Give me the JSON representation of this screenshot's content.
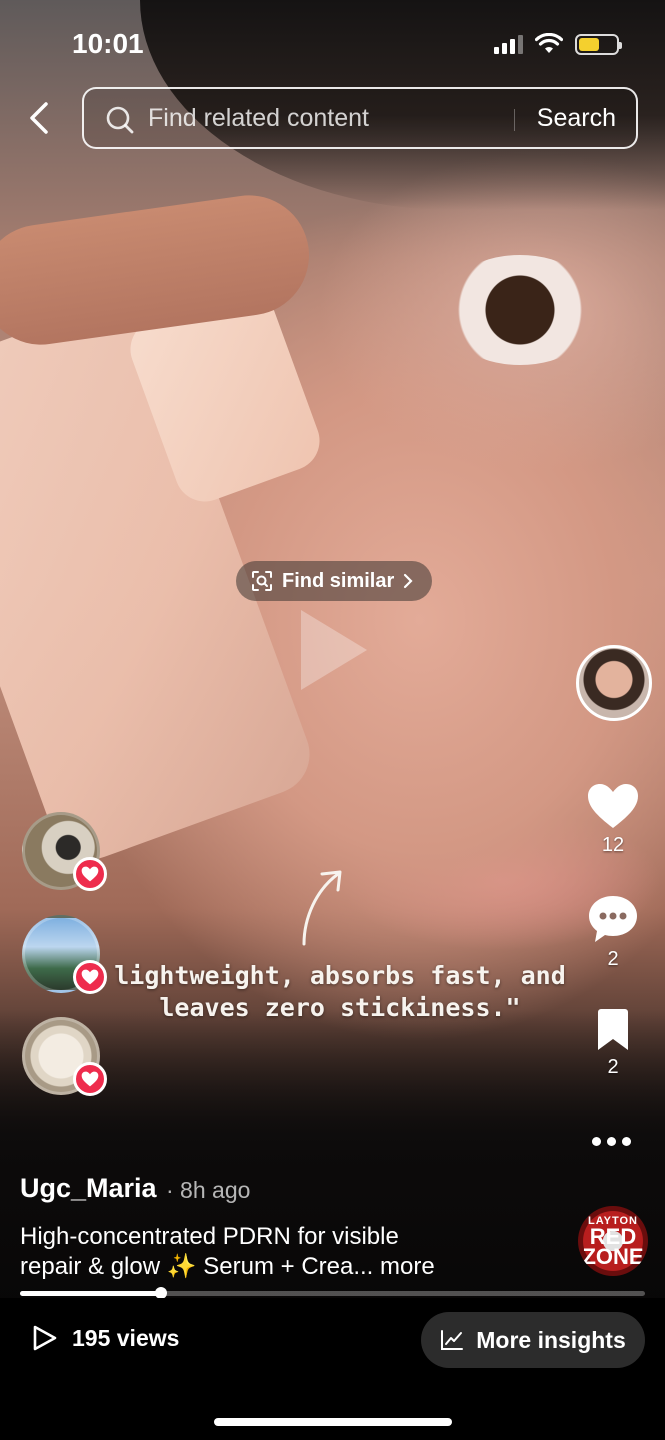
{
  "status_bar": {
    "time": "10:01"
  },
  "search": {
    "placeholder": "Find related content",
    "button_label": "Search"
  },
  "find_similar": {
    "label": "Find similar"
  },
  "actions": {
    "likes": "12",
    "comments": "2",
    "bookmarks": "2"
  },
  "video": {
    "caption_line1": "lightweight, absorbs fast, and",
    "caption_line2": "leaves zero stickiness.\""
  },
  "music": {
    "disc_small": "LAYTON",
    "disc_big_1": "RED",
    "disc_big_2": "ZONE"
  },
  "post": {
    "username": "Ugc_Maria",
    "time": "· 8h ago",
    "description_line1": "High-concentrated PDRN for visible",
    "description_line2": "repair & glow ✨ Serum + Crea...",
    "more_label": "more",
    "progress_fraction": 0.226
  },
  "bottom": {
    "views": "195 views",
    "insights_label": "More insights"
  },
  "colors": {
    "like_heart": "#ee2c4d",
    "battery": "#f4d02e"
  }
}
